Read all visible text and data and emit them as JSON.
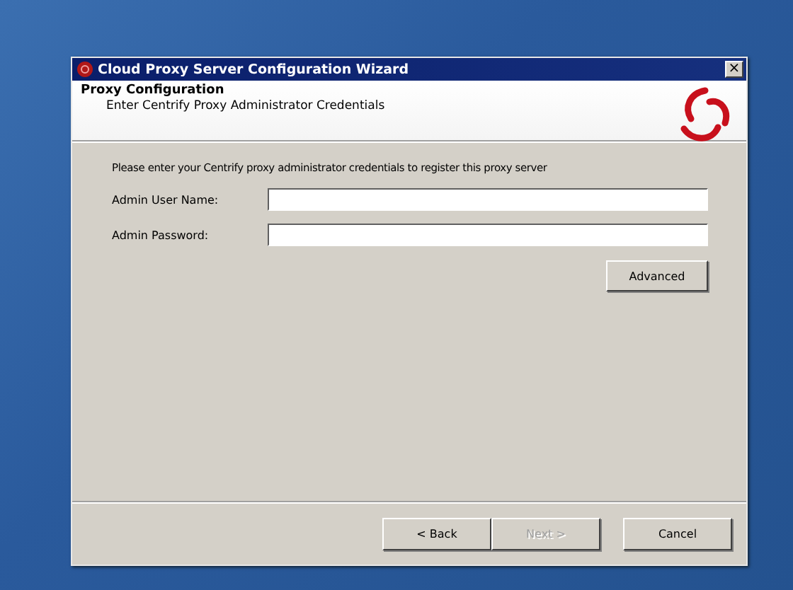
{
  "window": {
    "title": "Cloud Proxy Server Configuration Wizard",
    "close": "×"
  },
  "header": {
    "title": "Proxy Configuration",
    "subtitle": "Enter Centrify Proxy Administrator Credentials"
  },
  "instruction": "Please enter your Centrify proxy administrator credentials to register this proxy server",
  "fields": [
    {
      "label": "Admin User Name:"
    },
    {
      "label": "Admin Password:"
    }
  ],
  "advanced_button": "Advanced",
  "buttons": [
    {
      "label": "< Back",
      "disabled": false
    },
    {
      "label": "Next >",
      "disabled": true
    },
    {
      "label": "Cancel",
      "disabled": false
    }
  ]
}
